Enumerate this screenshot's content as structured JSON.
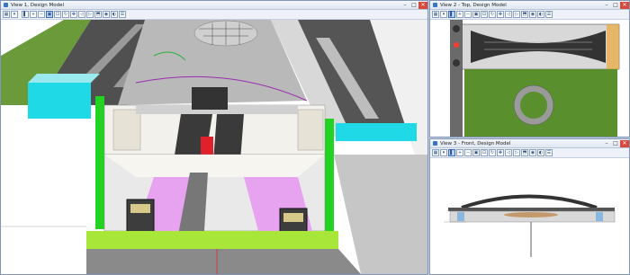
{
  "views": {
    "view1": {
      "title": "View 1, Design Model"
    },
    "view2": {
      "title": "View 2 - Top, Design Model"
    },
    "view3": {
      "title": "View 3 - Front, Design Model"
    }
  },
  "window_controls": {
    "minimize": "–",
    "maximize": "□",
    "close": "✕"
  },
  "toolbar_icons": [
    "view-attributes-icon",
    "display-style-icon",
    "update-icon",
    "zoom-in-icon",
    "zoom-out-icon",
    "window-area-icon",
    "fit-view-icon",
    "rotate-icon",
    "pan-icon",
    "previous-view-icon",
    "next-view-icon",
    "clip-volume-icon",
    "camera-icon",
    "render-icon",
    "view-toggles-icon"
  ],
  "colors": {
    "accent_window_border": "#7f96b8",
    "cyan_wall": "#1fd9e6",
    "green_wall": "#22d322",
    "lime_floor": "#a8e63a",
    "pink_platform": "#e8a3f0",
    "grass": "#5a8f2e"
  }
}
